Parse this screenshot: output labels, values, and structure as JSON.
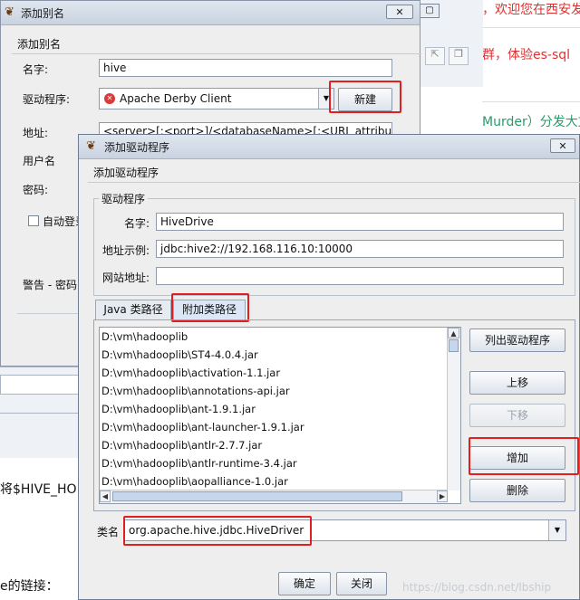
{
  "background": {
    "line1": "，欢迎您在西安发",
    "line2": "群，体验es-sql",
    "line3": "Murder）分发大文",
    "line4": "将$HIVE_HO",
    "line5": "e的链接："
  },
  "alias_dialog": {
    "title": "添加别名",
    "header": "添加别名",
    "name_label": "名字:",
    "name_value": "hive",
    "driver_label": "驱动程序:",
    "driver_value": "Apache Derby Client",
    "new_button": "新建",
    "url_label": "地址:",
    "url_value": "<server>[:<port>]/<databaseName>[;<URL attribute>=<value>]",
    "user_label": "用户名",
    "password_label": "密码:",
    "autologin_label": "自动登录",
    "warning_label": "警告 - 密码"
  },
  "driver_dialog": {
    "title": "添加驱动程序",
    "header": "添加驱动程序",
    "group_label": "驱动程序",
    "name_label": "名字:",
    "name_value": "HiveDrive",
    "example_url_label": "地址示例:",
    "example_url_value": "jdbc:hive2://192.168.116.10:10000",
    "website_label": "网站地址:",
    "website_value": "",
    "tabs": [
      "Java 类路径",
      "附加类路径"
    ],
    "classpath_items": [
      "D:\\vm\\hadooplib",
      "D:\\vm\\hadooplib\\ST4-4.0.4.jar",
      "D:\\vm\\hadooplib\\activation-1.1.jar",
      "D:\\vm\\hadooplib\\annotations-api.jar",
      "D:\\vm\\hadooplib\\ant-1.9.1.jar",
      "D:\\vm\\hadooplib\\ant-launcher-1.9.1.jar",
      "D:\\vm\\hadooplib\\antlr-2.7.7.jar",
      "D:\\vm\\hadooplib\\antlr-runtime-3.4.jar",
      "D:\\vm\\hadooplib\\aopalliance-1.0.jar"
    ],
    "list_drivers_button": "列出驱动程序",
    "move_up_button": "上移",
    "move_down_button": "下移",
    "add_button": "增加",
    "delete_button": "删除",
    "class_name_label": "类名",
    "class_name_value": "org.apache.hive.jdbc.HiveDriver",
    "ok_button": "确定",
    "close_button": "关闭"
  },
  "watermark": "https://blog.csdn.net/lbship",
  "colors": {
    "highlight": "#e02020",
    "error_icon": "#d93a3a",
    "title_bg": "#c9d3e0"
  }
}
